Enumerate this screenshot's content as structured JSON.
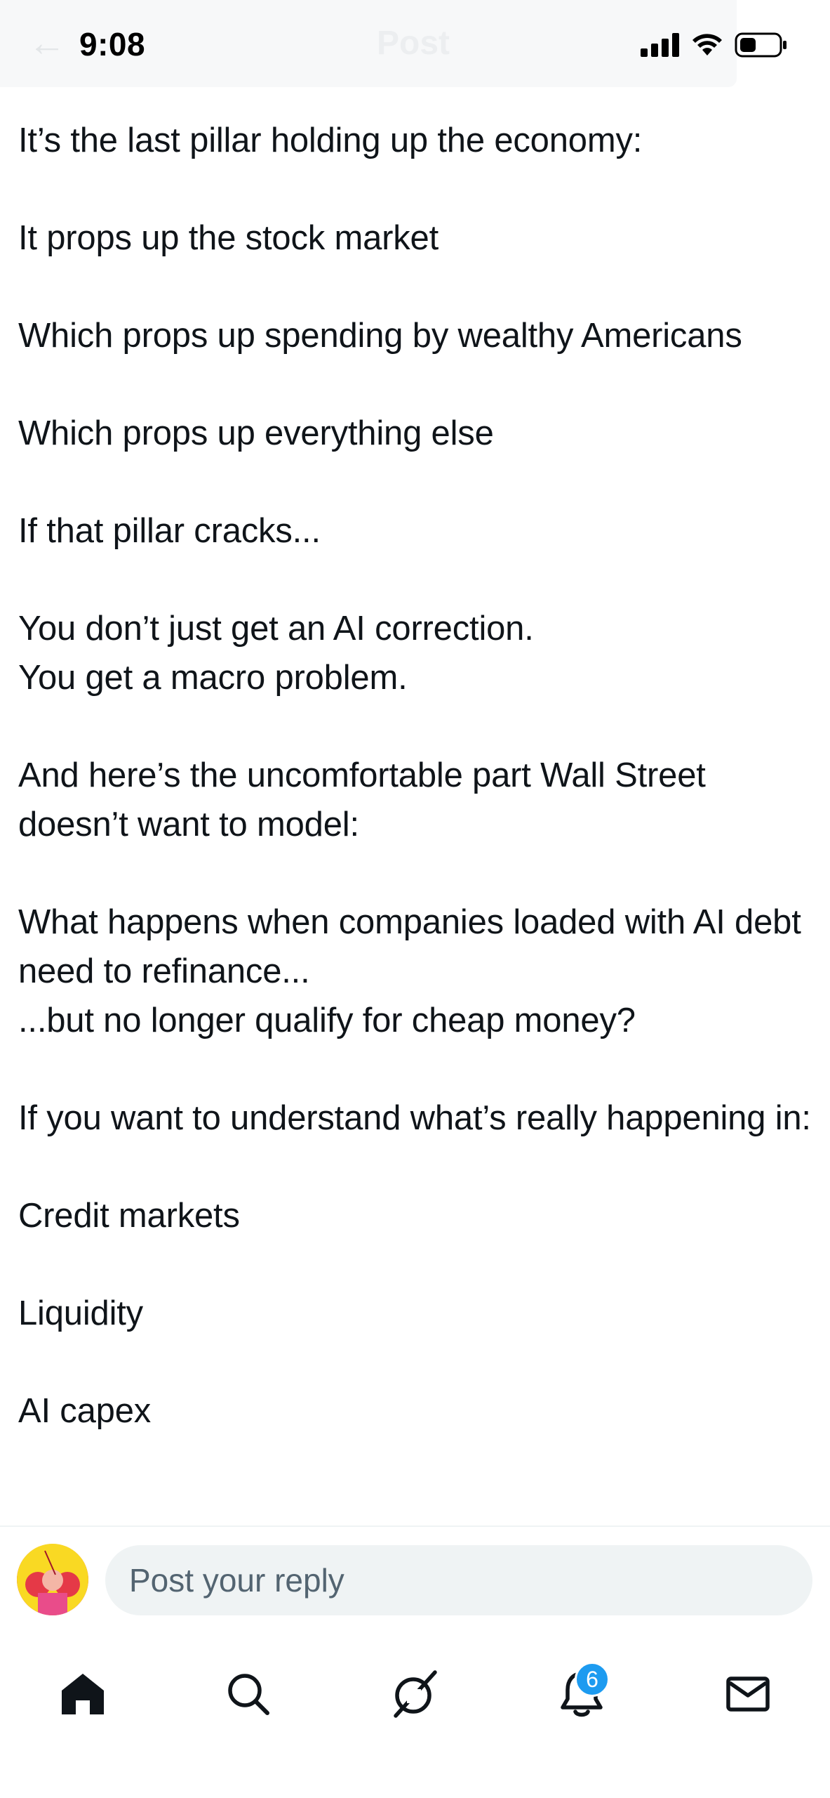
{
  "status_bar": {
    "time": "9:08"
  },
  "header": {
    "title": "Post",
    "back_icon": "back-arrow-icon"
  },
  "post": {
    "paragraphs": [
      "It’s the last pillar holding up the economy:",
      "It props up the stock market",
      "Which props up spending by wealthy Americans",
      "Which props up everything else",
      "If that pillar cracks...",
      "You don’t just get an AI correction.\nYou get a macro problem.",
      "And here’s the uncomfortable part Wall Street doesn’t want to model:",
      "What happens when companies loaded with AI debt need to refinance...\n...but no longer qualify for cheap money?",
      "If you want to understand what’s really happening in:",
      "Credit markets",
      "Liquidity",
      "AI capex"
    ]
  },
  "reply": {
    "placeholder": "Post your reply"
  },
  "nav": {
    "items": [
      {
        "name": "home",
        "icon": "home-icon"
      },
      {
        "name": "search",
        "icon": "search-icon"
      },
      {
        "name": "grok",
        "icon": "grok-icon"
      },
      {
        "name": "notifications",
        "icon": "bell-icon",
        "badge": "6"
      },
      {
        "name": "messages",
        "icon": "mail-icon"
      }
    ]
  },
  "colors": {
    "text": "#0f1419",
    "muted": "#536471",
    "accent": "#1d9bf0",
    "input_bg": "#eff3f4"
  }
}
